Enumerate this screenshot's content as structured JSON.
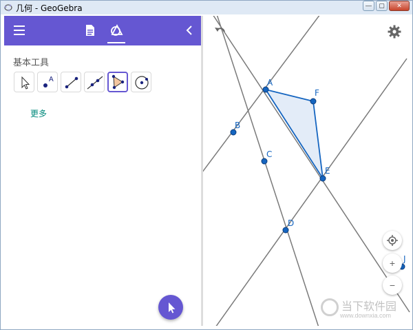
{
  "window": {
    "title": "几何 - GeoGebra",
    "controls": {
      "minimize": "—",
      "restore": "▢",
      "close": "✕"
    }
  },
  "left_panel": {
    "section_title": "基本工具",
    "more_link": "更多",
    "tools": [
      "move-tool",
      "point-tool",
      "segment-tool",
      "line-tool",
      "polygon-tool",
      "circle-tool"
    ],
    "active_tool": "polygon-tool",
    "accent_color": "#6557d2"
  },
  "graphics": {
    "points": {
      "A": "A",
      "B": "B",
      "C": "C",
      "D": "D",
      "E": "E",
      "F": "F",
      "J": "J"
    },
    "zoom_in": "+",
    "zoom_out": "−"
  },
  "watermark": {
    "brand": "当下软件园",
    "url": "www.downxia.com"
  }
}
